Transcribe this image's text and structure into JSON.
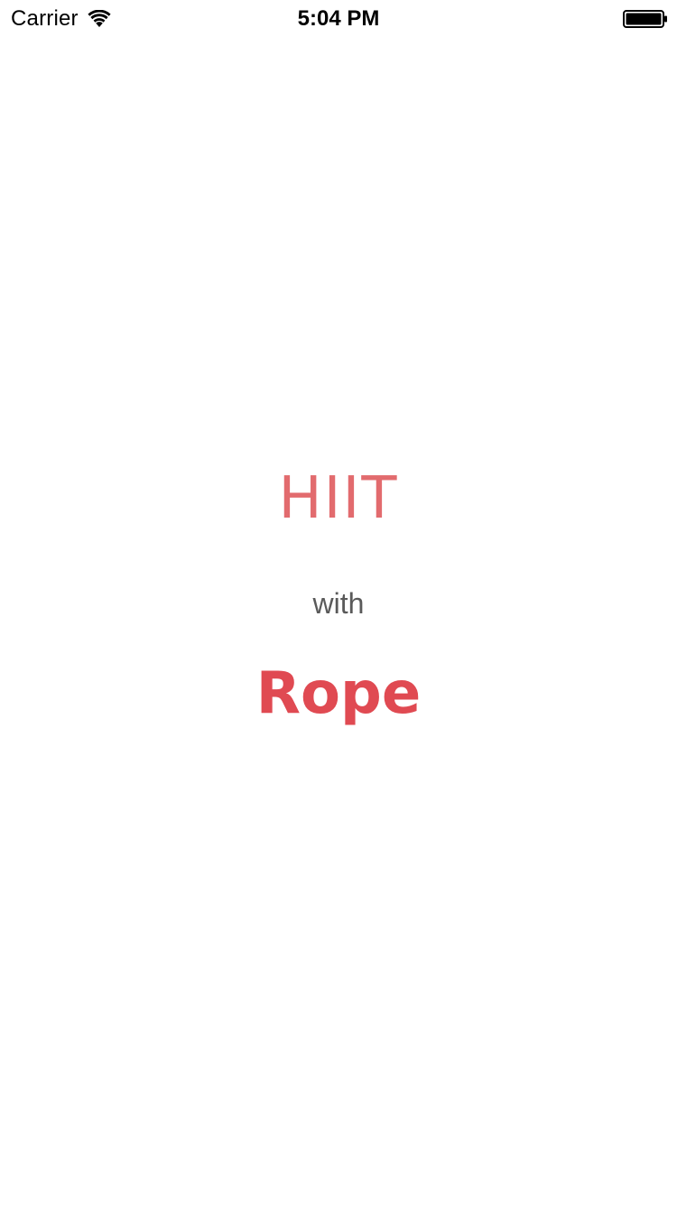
{
  "status_bar": {
    "carrier": "Carrier",
    "time": "5:04 PM",
    "wifi_icon": "wifi-icon",
    "battery_icon": "battery-icon"
  },
  "splash": {
    "line1": "HIIT",
    "line2": "with",
    "line3": "Rope"
  },
  "colors": {
    "background": "#ffffff",
    "hiit_text": "#e26b6e",
    "with_text": "#5a5a5a",
    "rope_text": "#e04a52"
  }
}
